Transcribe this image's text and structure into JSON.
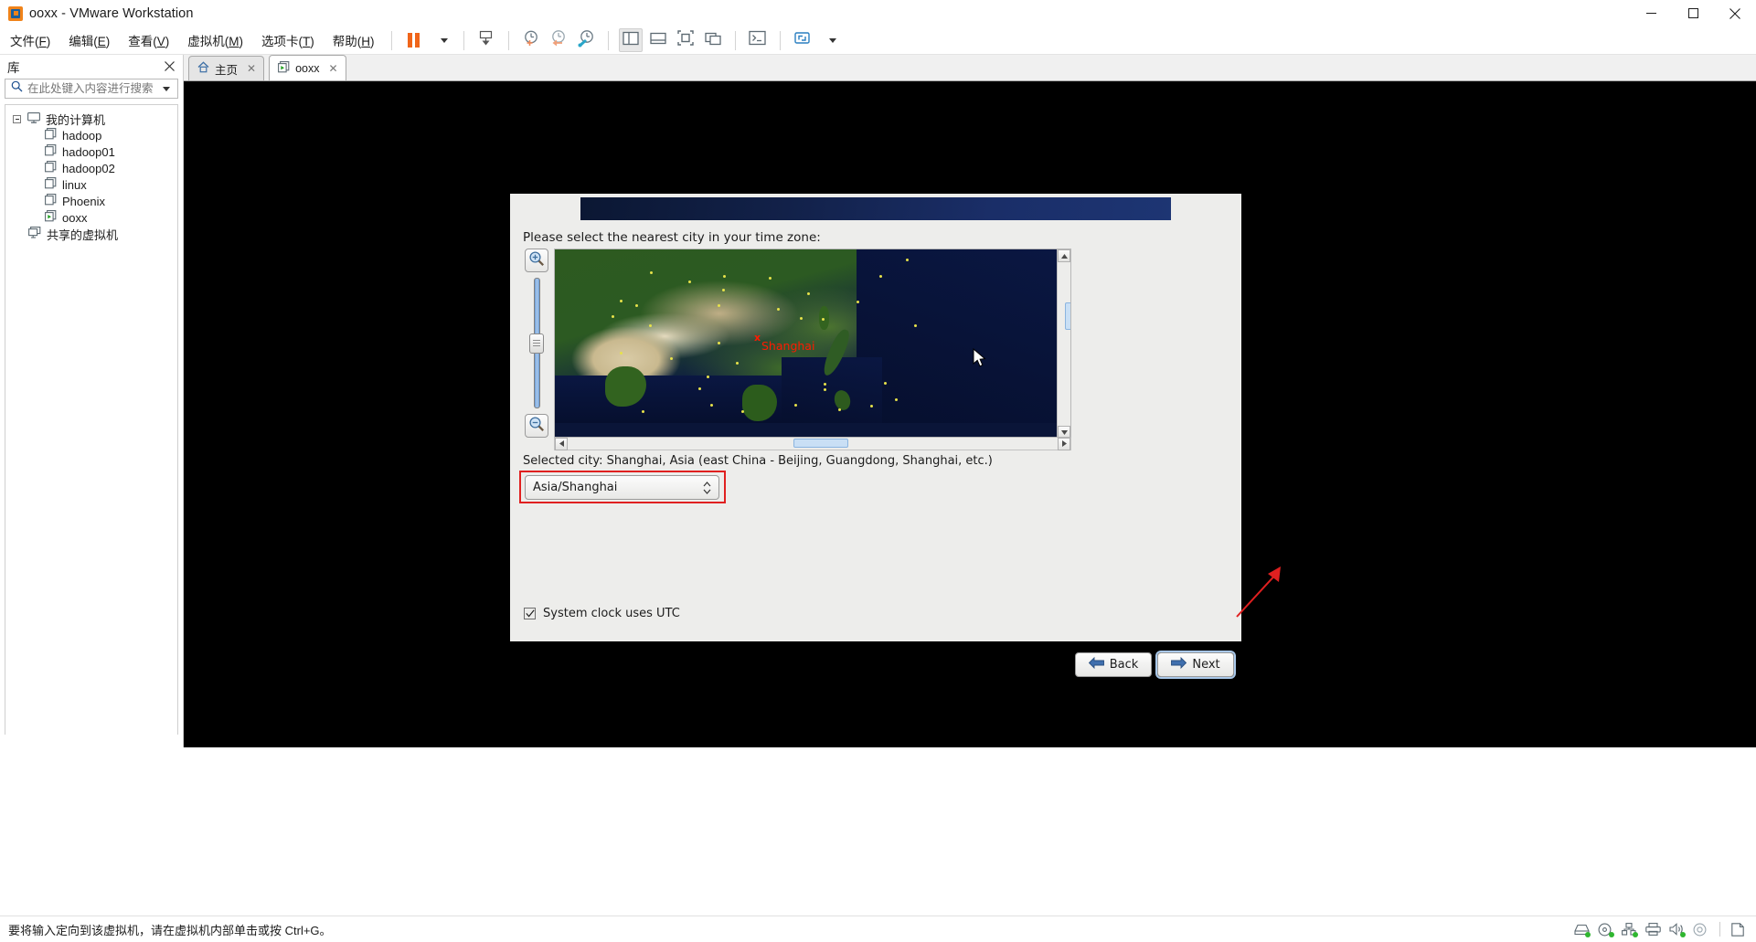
{
  "window": {
    "title": "ooxx - VMware Workstation",
    "app_icon": "vmware-logo-icon",
    "minimize_label": "─",
    "maximize_label": "☐",
    "close_label": "✕"
  },
  "menubar": {
    "items": [
      {
        "name": "file",
        "text": "文件(F)",
        "pre": "文件(",
        "key": "F",
        "post": ")"
      },
      {
        "name": "edit",
        "text": "编辑(E)",
        "pre": "编辑(",
        "key": "E",
        "post": ")"
      },
      {
        "name": "view",
        "text": "查看(V)",
        "pre": "查看(",
        "key": "V",
        "post": ")"
      },
      {
        "name": "vm",
        "text": "虚拟机(M)",
        "pre": "虚拟机(",
        "key": "M",
        "post": ")"
      },
      {
        "name": "tabs",
        "text": "选项卡(T)",
        "pre": "选项卡(",
        "key": "T",
        "post": ")"
      },
      {
        "name": "help",
        "text": "帮助(H)",
        "pre": "帮助(",
        "key": "H",
        "post": ")"
      }
    ]
  },
  "toolbar": {
    "buttons": [
      {
        "name": "suspend-button",
        "icon": "pause-icon"
      },
      {
        "name": "power-dropdown",
        "icon": "chevron-down-icon"
      },
      {
        "name": "send-ctrl-alt-del-button",
        "icon": "keyboard-send-icon"
      },
      {
        "name": "take-snapshot-button",
        "icon": "snapshot-add-icon"
      },
      {
        "name": "revert-snapshot-button",
        "icon": "snapshot-revert-icon"
      },
      {
        "name": "snapshot-manager-button",
        "icon": "snapshot-manager-icon"
      },
      {
        "name": "show-library-button",
        "icon": "panel-left-icon"
      },
      {
        "name": "show-thumbnail-bar-button",
        "icon": "panel-bottom-icon"
      },
      {
        "name": "full-screen-button",
        "icon": "fullscreen-icon"
      },
      {
        "name": "unity-mode-button",
        "icon": "unity-icon"
      },
      {
        "name": "console-button",
        "icon": "console-icon"
      },
      {
        "name": "stretch-dropdown",
        "icon": "chevron-down-icon"
      }
    ]
  },
  "library": {
    "title": "库",
    "close_icon": "close-icon",
    "search": {
      "placeholder": "在此处键入内容进行搜索",
      "value": "",
      "icon": "search-icon",
      "dropdown_icon": "chevron-down-icon"
    },
    "tree": [
      {
        "label": "我的计算机",
        "level": 0,
        "icon": "computer-icon",
        "expanded": true
      },
      {
        "label": "hadoop",
        "level": 1,
        "icon": "vm-icon"
      },
      {
        "label": "hadoop01",
        "level": 1,
        "icon": "vm-icon"
      },
      {
        "label": "hadoop02",
        "level": 1,
        "icon": "vm-icon"
      },
      {
        "label": "linux",
        "level": 1,
        "icon": "vm-icon"
      },
      {
        "label": "Phoenix",
        "level": 1,
        "icon": "vm-icon"
      },
      {
        "label": "ooxx",
        "level": 1,
        "icon": "vm-running-icon"
      },
      {
        "label": "共享的虚拟机",
        "level": 0,
        "icon": "shared-vms-icon"
      }
    ]
  },
  "tabs": [
    {
      "label": "主页",
      "icon": "home-icon",
      "selected": false,
      "close_icon": "✕"
    },
    {
      "label": "ooxx",
      "icon": "vm-running-icon",
      "selected": true,
      "close_icon": "✕"
    }
  ],
  "dialog": {
    "prompt": "Please select the nearest city in your time zone:",
    "map": {
      "zoom_in_icon": "zoom-in-icon",
      "zoom_out_icon": "zoom-out-icon",
      "selected_marker": "x",
      "selected_city_label": "Shanghai",
      "h_scroll_left_icon": "◀",
      "h_scroll_right_icon": "▶",
      "v_scroll_up_icon": "▲",
      "v_scroll_down_icon": "▼"
    },
    "selected_city_text": "Selected city: Shanghai, Asia (east China - Beijing, Guangdong, Shanghai, etc.)",
    "timezone_select": {
      "value": "Asia/Shanghai",
      "spinner_icon": "spinner-updown-icon",
      "highlight_color": "#e02020"
    },
    "utc_checkbox": {
      "label": "System clock uses UTC",
      "checked": true,
      "check_glyph": "✓"
    },
    "buttons": [
      {
        "name": "back-button",
        "label": "Back",
        "icon": "arrow-left-icon"
      },
      {
        "name": "next-button",
        "label": "Next",
        "icon": "arrow-right-icon",
        "focused": true
      }
    ],
    "annotation_arrow_color": "#e02020"
  },
  "statusbar": {
    "text": "要将输入定向到该虚拟机，请在虚拟机内部单击或按 Ctrl+G。",
    "icons": [
      {
        "name": "hard-disk-icon"
      },
      {
        "name": "cd-dvd-icon"
      },
      {
        "name": "network-adapter-icon"
      },
      {
        "name": "printer-icon"
      },
      {
        "name": "sound-card-icon"
      },
      {
        "name": "usb-icon"
      },
      {
        "name": "message-log-icon"
      }
    ]
  }
}
